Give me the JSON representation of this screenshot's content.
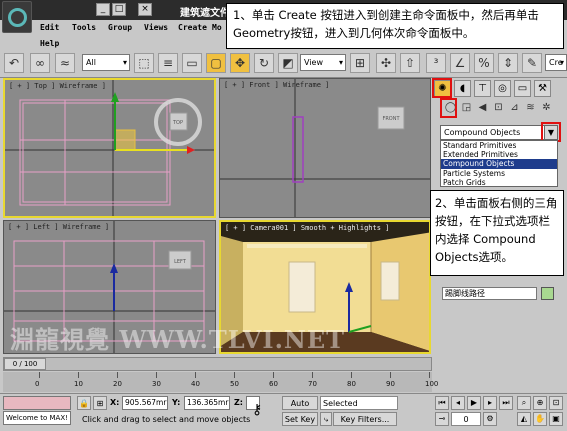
{
  "window": {
    "title": "建筑遮文件",
    "minimize_label": "_",
    "maximize_label": "□",
    "close_label": "×"
  },
  "menu": [
    "Edit",
    "Tools",
    "Group",
    "Views",
    "Create",
    "Mo",
    "Help"
  ],
  "callout_1": "1、单击 Create 按钮进入到创建主命令面板中，然后再单击 Geometry按钮，进入到几何体次命令面板中。",
  "callout_2": "2、单击面板右侧的三角按钮，在下拉式选项栏内选择 Compound Objects选项。",
  "toolbar": {
    "selection_filter": "All",
    "reference_coord": "View",
    "create_label": "Cre"
  },
  "viewports": {
    "top": "[ + ] Top ] Wireframe ]",
    "front": "[ + ] Front ] Wireframe ]",
    "left": "[ + ] Left ] Wireframe ]",
    "camera": "[ + ] Camera001 ] Smooth + Highlights ]",
    "viewcube_top": "TOP",
    "viewcube_front": "FRONT",
    "viewcube_left": "LEFT"
  },
  "command_panel": {
    "category_value": "Compound Objects",
    "dropdown_options": [
      "Standard Primitives",
      "Extended Primitives",
      "Compound Objects",
      "Particle Systems",
      "Patch Grids"
    ],
    "selected_option_index": 2,
    "name_value": "踢脚线路径",
    "swatch_color": "#a8d890"
  },
  "time": {
    "slider_label": "0 / 100",
    "ticks": [
      "0",
      "10",
      "20",
      "30",
      "40",
      "50",
      "60",
      "70",
      "80",
      "90",
      "100"
    ]
  },
  "status": {
    "maxscript": "Welcome to MAX!",
    "x_label": "X:",
    "x_value": "905.567mr",
    "y_label": "Y:",
    "y_value": "136.365mr",
    "z_label": "Z:",
    "prompt": "Click and drag to select and move objects",
    "auto_key": "Auto Key",
    "set_key": "Set Key",
    "key_mode": "Selected",
    "key_filters": "Key Filters...",
    "frame": "0"
  },
  "watermark": "淵龍視覺 WWW.TLVI.NET",
  "colors": {
    "highlight_border": "#e8d830",
    "callout_red": "#e01010",
    "selected_option_bg": "#1e3c8c"
  }
}
